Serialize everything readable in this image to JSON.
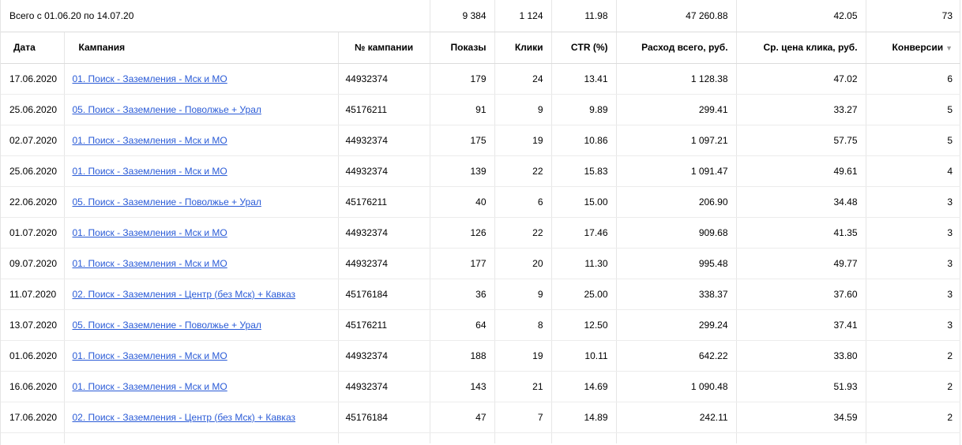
{
  "totals": {
    "label": "Всего с 01.06.20 по 14.07.20",
    "shows": "9 384",
    "clicks": "1 124",
    "ctr": "11.98",
    "cost": "47 260.88",
    "avg_cpc": "42.05",
    "conversions": "73"
  },
  "columns": {
    "date": "Дата",
    "campaign": "Кампания",
    "campaign_no": "№ кампании",
    "shows": "Показы",
    "clicks": "Клики",
    "ctr": "CTR (%)",
    "cost": "Расход всего, руб.",
    "avg_cpc": "Ср. цена клика, руб.",
    "conversions": "Конверсии"
  },
  "rows": [
    {
      "date": "17.06.2020",
      "campaign": "01. Поиск - Заземления - Мск и МО",
      "campaign_no": "44932374",
      "shows": "179",
      "clicks": "24",
      "ctr": "13.41",
      "cost": "1 128.38",
      "avg_cpc": "47.02",
      "conversions": "6"
    },
    {
      "date": "25.06.2020",
      "campaign": "05. Поиск - Заземление - Поволжье + Урал",
      "campaign_no": "45176211",
      "shows": "91",
      "clicks": "9",
      "ctr": "9.89",
      "cost": "299.41",
      "avg_cpc": "33.27",
      "conversions": "5"
    },
    {
      "date": "02.07.2020",
      "campaign": "01. Поиск - Заземления - Мск и МО",
      "campaign_no": "44932374",
      "shows": "175",
      "clicks": "19",
      "ctr": "10.86",
      "cost": "1 097.21",
      "avg_cpc": "57.75",
      "conversions": "5"
    },
    {
      "date": "25.06.2020",
      "campaign": "01. Поиск - Заземления - Мск и МО",
      "campaign_no": "44932374",
      "shows": "139",
      "clicks": "22",
      "ctr": "15.83",
      "cost": "1 091.47",
      "avg_cpc": "49.61",
      "conversions": "4"
    },
    {
      "date": "22.06.2020",
      "campaign": "05. Поиск - Заземление - Поволжье + Урал",
      "campaign_no": "45176211",
      "shows": "40",
      "clicks": "6",
      "ctr": "15.00",
      "cost": "206.90",
      "avg_cpc": "34.48",
      "conversions": "3"
    },
    {
      "date": "01.07.2020",
      "campaign": "01. Поиск - Заземления - Мск и МО",
      "campaign_no": "44932374",
      "shows": "126",
      "clicks": "22",
      "ctr": "17.46",
      "cost": "909.68",
      "avg_cpc": "41.35",
      "conversions": "3"
    },
    {
      "date": "09.07.2020",
      "campaign": "01. Поиск - Заземления - Мск и МО",
      "campaign_no": "44932374",
      "shows": "177",
      "clicks": "20",
      "ctr": "11.30",
      "cost": "995.48",
      "avg_cpc": "49.77",
      "conversions": "3"
    },
    {
      "date": "11.07.2020",
      "campaign": "02. Поиск - Заземления - Центр (без Мск) + Кавказ",
      "campaign_no": "45176184",
      "shows": "36",
      "clicks": "9",
      "ctr": "25.00",
      "cost": "338.37",
      "avg_cpc": "37.60",
      "conversions": "3"
    },
    {
      "date": "13.07.2020",
      "campaign": "05. Поиск - Заземление - Поволжье + Урал",
      "campaign_no": "45176211",
      "shows": "64",
      "clicks": "8",
      "ctr": "12.50",
      "cost": "299.24",
      "avg_cpc": "37.41",
      "conversions": "3"
    },
    {
      "date": "01.06.2020",
      "campaign": "01. Поиск - Заземления - Мск и МО",
      "campaign_no": "44932374",
      "shows": "188",
      "clicks": "19",
      "ctr": "10.11",
      "cost": "642.22",
      "avg_cpc": "33.80",
      "conversions": "2"
    },
    {
      "date": "16.06.2020",
      "campaign": "01. Поиск - Заземления - Мск и МО",
      "campaign_no": "44932374",
      "shows": "143",
      "clicks": "21",
      "ctr": "14.69",
      "cost": "1 090.48",
      "avg_cpc": "51.93",
      "conversions": "2"
    },
    {
      "date": "17.06.2020",
      "campaign": "02. Поиск - Заземления - Центр (без Мск) + Кавказ",
      "campaign_no": "45176184",
      "shows": "47",
      "clicks": "7",
      "ctr": "14.89",
      "cost": "242.11",
      "avg_cpc": "34.59",
      "conversions": "2"
    }
  ],
  "icons": {
    "sort": "sort-desc-icon"
  }
}
